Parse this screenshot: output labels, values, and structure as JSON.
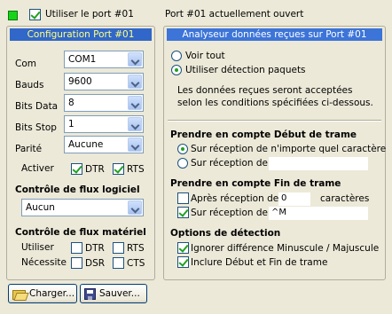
{
  "top": {
    "use_port_label": "Utiliser le port #01",
    "use_port_checked": true,
    "port_status": "Port #01 actuellement ouvert"
  },
  "config": {
    "title": "Configuration Port #01",
    "com_label": "Com",
    "com_value": "COM1",
    "bauds_label": "Bauds",
    "bauds_value": "9600",
    "bits_data_label": "Bits Data",
    "bits_data_value": "8",
    "bits_stop_label": "Bits Stop",
    "bits_stop_value": "1",
    "parity_label": "Parité",
    "parity_value": "Aucune",
    "activate_label": "Activer",
    "dtr_label": "DTR",
    "dtr_checked": true,
    "rts_label": "RTS",
    "rts_checked": true,
    "soft_flow_title": "Contrôle de flux logiciel",
    "soft_flow_value": "Aucun",
    "hard_flow_title": "Contrôle de flux matériel",
    "use_label": "Utiliser",
    "need_label": "Nécessite",
    "hw_dtr_label": "DTR",
    "hw_rts_label": "RTS",
    "hw_dsr_label": "DSR",
    "hw_cts_label": "CTS"
  },
  "analyser": {
    "title": "Analyseur données reçues sur Port #01",
    "see_all_label": "Voir tout",
    "use_detection_label": "Utiliser détection paquets",
    "description_line1": "Les données reçues seront acceptées",
    "description_line2": "selon les conditions spécifiées ci-dessous.",
    "start_title": "Prendre en compte Début de trame",
    "start_any_label": "Sur réception de n'importe quel caractère",
    "start_on_label": "Sur réception de",
    "start_on_value": "",
    "end_title": "Prendre en compte Fin de trame",
    "end_after_label": "Après réception de",
    "end_after_value": "0",
    "end_chars_label": "caractères",
    "end_on_label": "Sur réception de",
    "end_on_value": "^M",
    "options_title": "Options de détection",
    "ignore_case_label": "Ignorer différence Minuscule / Majuscule",
    "include_label": "Inclure Début et Fin de trame"
  },
  "buttons": {
    "load_label": "Charger...",
    "save_label": "Sauver..."
  },
  "colors": {
    "title_bar": "#3c74d8",
    "led_green": "#18d418"
  }
}
